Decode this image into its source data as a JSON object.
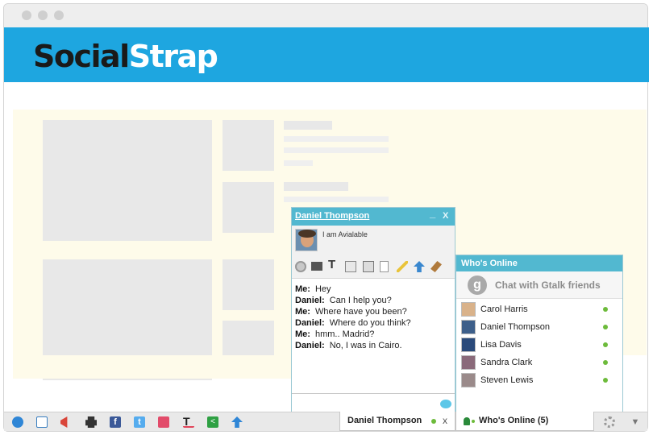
{
  "brand": {
    "part1": "Social",
    "part2": "Strap"
  },
  "chat": {
    "name": "Daniel Thompson",
    "status": "I am Avialable",
    "minimize": "_",
    "close": "X",
    "messages": [
      {
        "from": "Me:",
        "text": "Hey"
      },
      {
        "from": "Daniel:",
        "text": "Can I help you?"
      },
      {
        "from": "Me:",
        "text": "Where have you been?"
      },
      {
        "from": "Daniel:",
        "text": "Where do you think?"
      },
      {
        "from": "Me:",
        "text": "hmm.. Madrid?"
      },
      {
        "from": "Daniel:",
        "text": "No, I was in Cairo."
      }
    ],
    "toolbar_icons": [
      "webcam-icon",
      "monitor-icon",
      "text-format-icon",
      "edit-icon",
      "copy-icon",
      "card-icon",
      "pencil-icon",
      "upload-icon",
      "brush-icon"
    ]
  },
  "who": {
    "title": "Who's Online",
    "gtalk_label": "Chat with Gtalk friends",
    "g_letter": "g",
    "friends": [
      "Carol Harris",
      "Daniel Thompson",
      "Lisa Davis",
      "Sandra Clark",
      "Steven Lewis"
    ]
  },
  "bar": {
    "chat_tab": "Daniel Thompson",
    "chat_tab_close": "x",
    "who_tab": "Who's Online (5)",
    "icons": [
      "globe-icon",
      "id-card-icon",
      "megaphone-icon",
      "invader-icon",
      "facebook-icon",
      "twitter-icon",
      "square-icon",
      "text-icon",
      "share-icon",
      "upload-arrow-icon",
      "gear-icon",
      "chevron-down-icon"
    ]
  },
  "colors": {
    "accent": "#1ea6e0",
    "panel_head": "#52b8d0",
    "online": "#6dbb3b"
  }
}
